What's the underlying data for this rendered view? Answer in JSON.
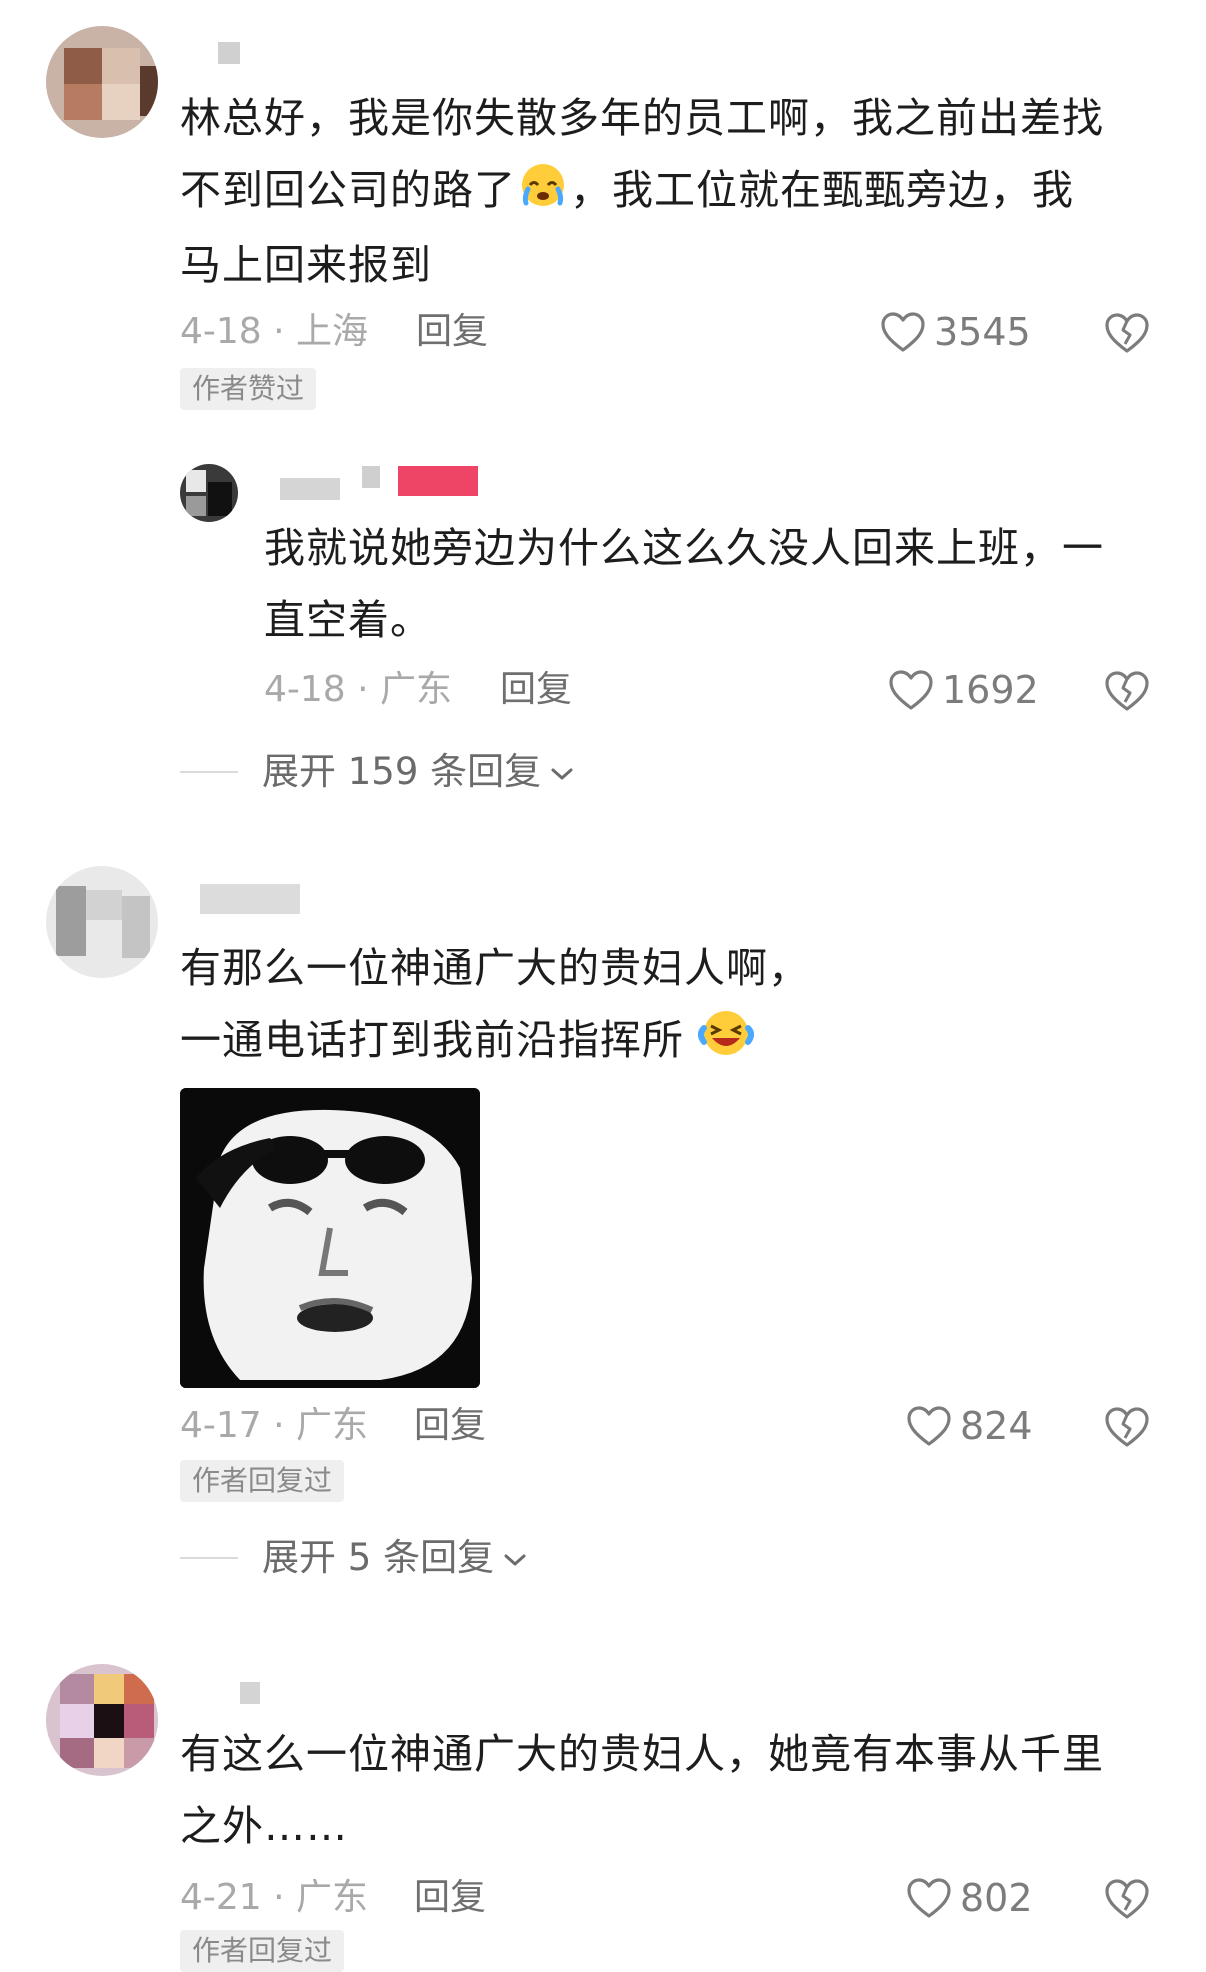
{
  "comments": [
    {
      "text_lines": [
        "林总好，我是你失散多年的员工啊，我之前出差找",
        "不到回公司的路了",
        "，我工位就在甄甄旁边，我",
        "马上回来报到"
      ],
      "emoji": "crying-face",
      "meta": "4-18 · 上海",
      "reply_label": "回复",
      "likes": "3545",
      "badge": "作者赞过",
      "replies": [
        {
          "text_lines": [
            "我就说她旁边为什么这么久没人回来上班，一",
            "直空着。"
          ],
          "meta": "4-18 · 广东",
          "reply_label": "回复",
          "likes": "1692"
        }
      ],
      "expand_label": "展开 159 条回复"
    },
    {
      "text_lines": [
        "有那么一位神通广大的贵妇人啊，",
        "一通电话打到我前沿指挥所"
      ],
      "emoji": "laughing-crying-face",
      "meta": "4-17 · 广东",
      "reply_label": "回复",
      "likes": "824",
      "badge": "作者回复过",
      "expand_label": "展开 5 条回复"
    },
    {
      "text_lines": [
        "有这么一位神通广大的贵妇人，她竟有本事从千里",
        "之外……"
      ],
      "meta": "4-21 · 广东",
      "reply_label": "回复",
      "likes": "802",
      "badge": "作者回复过"
    }
  ],
  "icons": {
    "like": "heart-outline-icon",
    "dislike": "broken-heart-icon",
    "expand": "chevron-down-icon"
  },
  "colors": {
    "text": "#1d1d1d",
    "meta": "#a9a9a9",
    "reply": "#6f6f6f",
    "badge_bg": "#efefef"
  }
}
